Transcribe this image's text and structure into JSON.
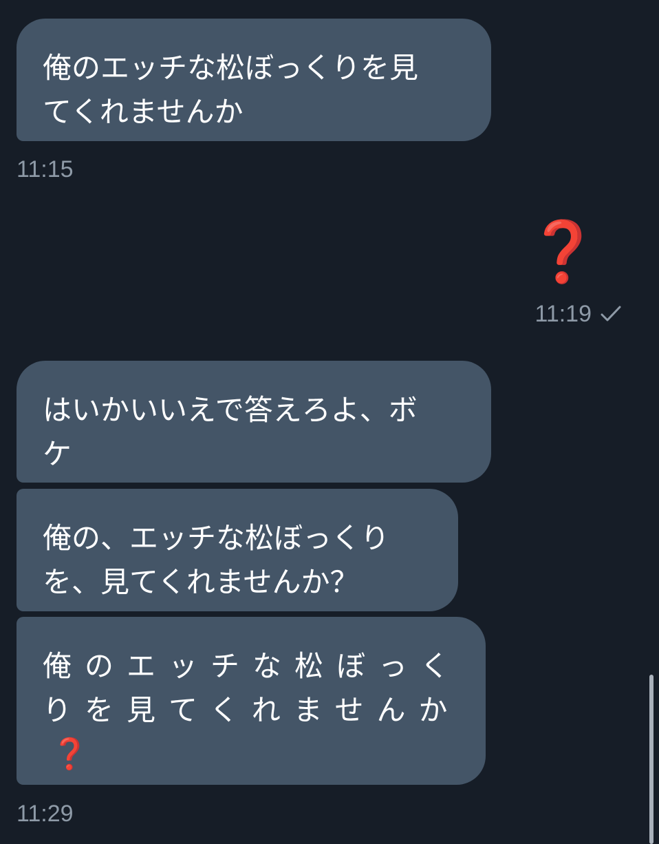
{
  "messages": [
    {
      "direction": "incoming",
      "lines": [
        "俺のエッチな松ぼっくりを見",
        "てくれませんか"
      ],
      "time": "11:15"
    },
    {
      "direction": "outgoing",
      "emoji": "❓",
      "time": "11:19",
      "status_icon": "check-icon"
    },
    {
      "direction": "incoming",
      "lines": [
        "はいかいいえで答えろよ、ボ",
        "ケ"
      ]
    },
    {
      "direction": "incoming",
      "lines": [
        "俺の、エッチな松ぼっくり",
        "を、見てくれませんか？"
      ]
    },
    {
      "direction": "incoming",
      "lines": [
        "俺のエッチな松ぼっく",
        "りを見てくれませんか"
      ],
      "trailing_emoji": "❓",
      "time": "11:29"
    }
  ],
  "colors": {
    "background": "#161d27",
    "bubble_incoming": "#445567",
    "timestamp": "#8e9aa7",
    "emoji_red": "#d0342c"
  }
}
